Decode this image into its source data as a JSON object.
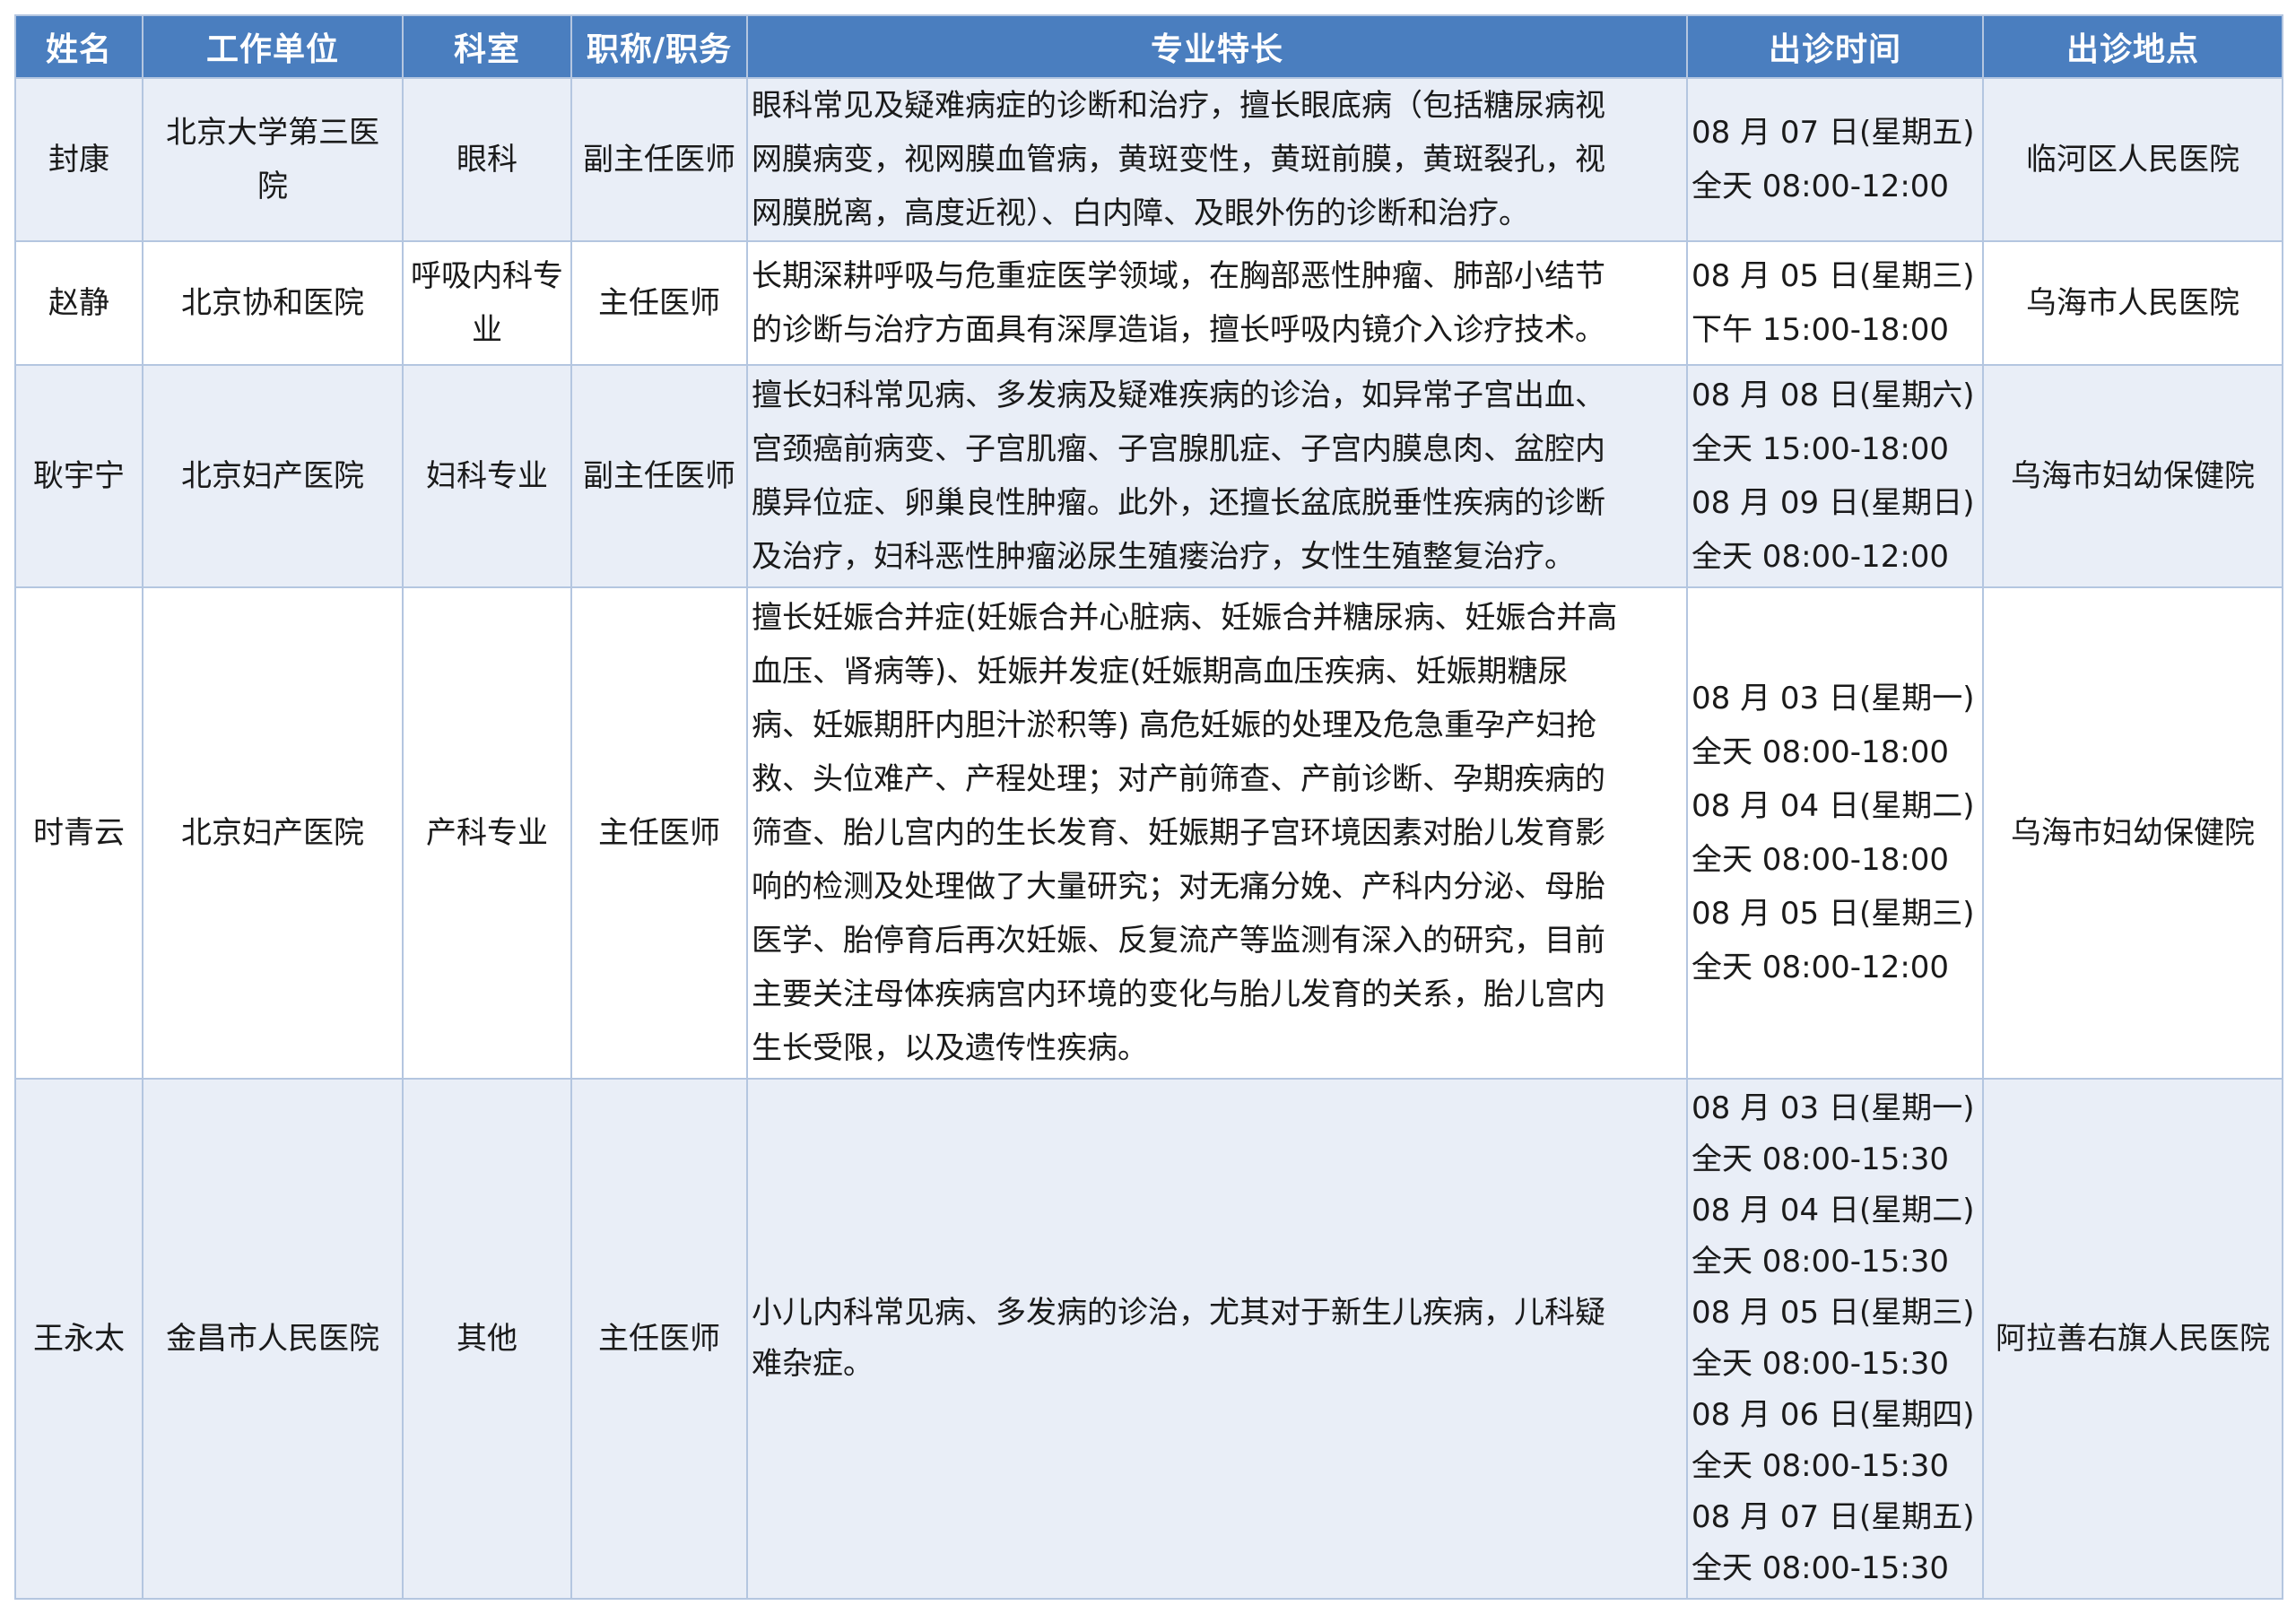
{
  "headers": [
    "姓名",
    "工作单位",
    "科室",
    "职称/职务",
    "专业特长",
    "出诊时间",
    "出诊地点"
  ],
  "rows": [
    {
      "name": "封康",
      "unit_lines": [
        "北京大学第三医",
        "院"
      ],
      "dept_lines": [
        "眼科"
      ],
      "title": "副主任医师",
      "specialty_lines": [
        "眼科常见及疑难病症的诊断和治疗，擅长眼底病（包括糖尿病视",
        "网膜病变，视网膜血管病，黄斑变性，黄斑前膜，黄斑裂孔，视",
        "网膜脱离，高度近视）、白内障、及眼外伤的诊断和治疗。"
      ],
      "schedule_lines": [
        "08 月 07 日(星期五)",
        "全天 08:00-12:00"
      ],
      "location": "临河区人民医院"
    },
    {
      "name": "赵静",
      "unit_lines": [
        "北京协和医院"
      ],
      "dept_lines": [
        "呼吸内科专",
        "业"
      ],
      "title": "主任医师",
      "specialty_lines": [
        "长期深耕呼吸与危重症医学领域，在胸部恶性肿瘤、肺部小结节",
        "的诊断与治疗方面具有深厚造诣，擅长呼吸内镜介入诊疗技术。"
      ],
      "schedule_lines": [
        "08 月 05 日(星期三)",
        "下午 15:00-18:00"
      ],
      "location": "乌海市人民医院"
    },
    {
      "name": "耿宇宁",
      "unit_lines": [
        "北京妇产医院"
      ],
      "dept_lines": [
        "妇科专业"
      ],
      "title": "副主任医师",
      "specialty_lines": [
        "擅长妇科常见病、多发病及疑难疾病的诊治，如异常子宫出血、",
        "宫颈癌前病变、子宫肌瘤、子宫腺肌症、子宫内膜息肉、盆腔内",
        "膜异位症、卵巢良性肿瘤。此外，还擅长盆底脱垂性疾病的诊断",
        "及治疗，妇科恶性肿瘤泌尿生殖瘘治疗，女性生殖整复治疗。"
      ],
      "schedule_lines": [
        "08 月 08 日(星期六)",
        "全天 15:00-18:00",
        "08 月 09 日(星期日)",
        "全天 08:00-12:00"
      ],
      "location": "乌海市妇幼保健院"
    },
    {
      "name": "时青云",
      "unit_lines": [
        "北京妇产医院"
      ],
      "dept_lines": [
        "产科专业"
      ],
      "title": "主任医师",
      "specialty_lines": [
        "擅长妊娠合并症(妊娠合并心脏病、妊娠合并糖尿病、妊娠合并高",
        "血压、肾病等)、妊娠并发症(妊娠期高血压疾病、妊娠期糖尿",
        "病、妊娠期肝内胆汁淤积等) 高危妊娠的处理及危急重孕产妇抢",
        "救、头位难产、产程处理；对产前筛查、产前诊断、孕期疾病的",
        "筛查、胎儿宫内的生长发育、妊娠期子宫环境因素对胎儿发育影",
        "响的检测及处理做了大量研究；对无痛分娩、产科内分泌、母胎",
        "医学、胎停育后再次妊娠、反复流产等监测有深入的研究，目前",
        "主要关注母体疾病宫内环境的变化与胎儿发育的关系，胎儿宫内",
        "生长受限，以及遗传性疾病。"
      ],
      "schedule_lines": [
        "08 月 03 日(星期一)",
        "全天 08:00-18:00",
        "08 月 04 日(星期二)",
        "全天 08:00-18:00",
        "08 月 05 日(星期三)",
        "全天 08:00-12:00"
      ],
      "location": "乌海市妇幼保健院"
    },
    {
      "name": "王永太",
      "unit_lines": [
        "金昌市人民医院"
      ],
      "dept_lines": [
        "其他"
      ],
      "title": "主任医师",
      "specialty_lines": [
        "小儿内科常见病、多发病的诊治，尤其对于新生儿疾病，儿科疑",
        "难杂症。"
      ],
      "schedule_lines": [
        "08 月 03 日(星期一)",
        "全天 08:00-15:30",
        "08 月 04 日(星期二)",
        "全天 08:00-15:30",
        "08 月 05 日(星期三)",
        "全天 08:00-15:30",
        "08 月 06 日(星期四)",
        "全天 08:00-15:30",
        "08 月 07 日(星期五)",
        "全天 08:00-15:30"
      ],
      "location": "阿拉善右旗人民医院"
    }
  ]
}
